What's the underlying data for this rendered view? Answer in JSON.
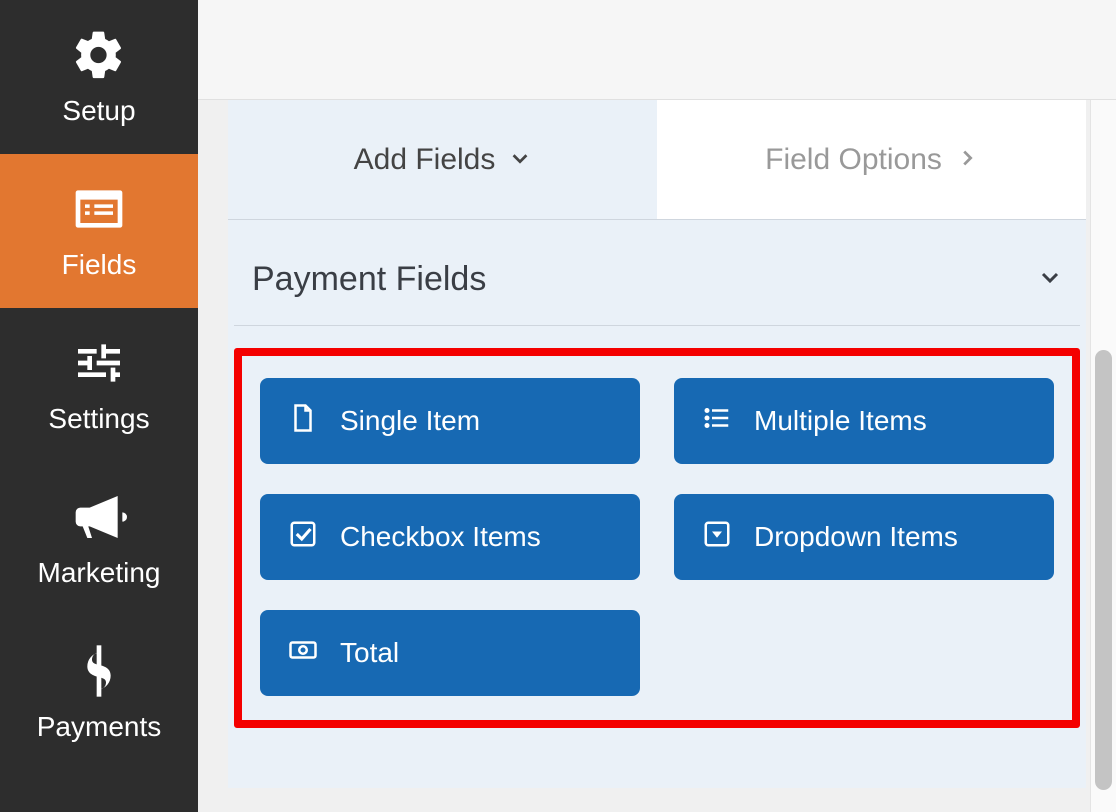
{
  "sidebar": {
    "items": [
      {
        "label": "Setup"
      },
      {
        "label": "Fields"
      },
      {
        "label": "Settings"
      },
      {
        "label": "Marketing"
      },
      {
        "label": "Payments"
      }
    ]
  },
  "tabs": {
    "add_fields": "Add Fields",
    "field_options": "Field Options"
  },
  "section": {
    "title": "Payment Fields"
  },
  "fields": {
    "single_item": "Single Item",
    "multiple_items": "Multiple Items",
    "checkbox_items": "Checkbox Items",
    "dropdown_items": "Dropdown Items",
    "total": "Total"
  }
}
